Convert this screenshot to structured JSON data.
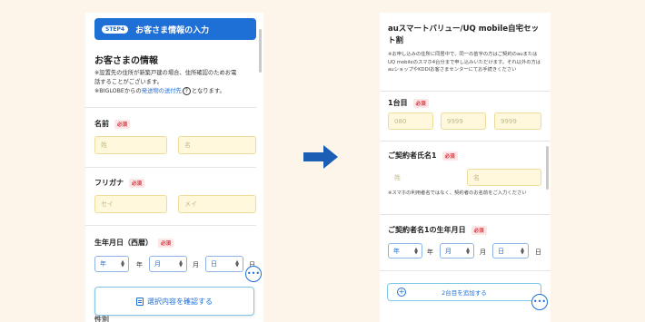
{
  "left": {
    "step": {
      "badge": "STEP4",
      "title": "お客さま情報の入力"
    },
    "section_title": "お客さまの情報",
    "note_line1": "※設置先の住所が新築戸建の場合、住所確認のためお電",
    "note_line2": "話することがございます。",
    "note_prefix": "※BIGLOBEからの",
    "note_link": "発送物の送付先",
    "note_help": "?",
    "note_suffix": "となります。",
    "name": {
      "label": "名前",
      "required": "必須",
      "sei": "姓",
      "mei": "名"
    },
    "furigana": {
      "label": "フリガナ",
      "required": "必須",
      "sei": "セイ",
      "mei": "メイ"
    },
    "birth": {
      "label": "生年月日（西暦）",
      "required": "必須",
      "year": "年",
      "year_unit": "年",
      "month": "月",
      "month_unit": "月",
      "day": "日",
      "day_unit": "日"
    },
    "confirm_button": "選択内容を確認する",
    "peek_label": "性別"
  },
  "right": {
    "title": "auスマートバリュー/UQ mobile自宅セット割",
    "note": "※お申し込みの住所に同居中で、同一の苗字の方はご契約のauまたはUQ mobileのスマホ4台分まで申し込みいただけます。それ以外の方はauショップやKDDIお客さまセンターにてお手続きください",
    "first": {
      "label": "1台目",
      "required": "必須",
      "tel1": "080",
      "tel2": "9999",
      "tel3": "9999"
    },
    "holder": {
      "label": "ご契約者氏名1",
      "required": "必須",
      "sei": "姓",
      "mei": "名"
    },
    "holder_note": "※スマホの利用者名ではなく、契約者のお名前をご入力ください",
    "holder_birth": {
      "label": "ご契約者名1の生年月日",
      "required": "必須",
      "year": "年",
      "year_unit": "年",
      "month": "月",
      "month_unit": "月",
      "day": "日",
      "day_unit": "日"
    },
    "add_button": "2台目を追加する",
    "add_plus": "⊕"
  },
  "chat_glyph": "•••",
  "colors": {
    "accent": "#1e6fd6",
    "required": "#e0303a",
    "input_bg": "#fff8dc",
    "arrow": "#1a5fb4",
    "background": "#fdf4ea"
  },
  "icons": {
    "arrow": "right-arrow-icon",
    "chat": "chat-bubble-icon",
    "document": "document-icon",
    "plus": "plus-circle-icon"
  }
}
